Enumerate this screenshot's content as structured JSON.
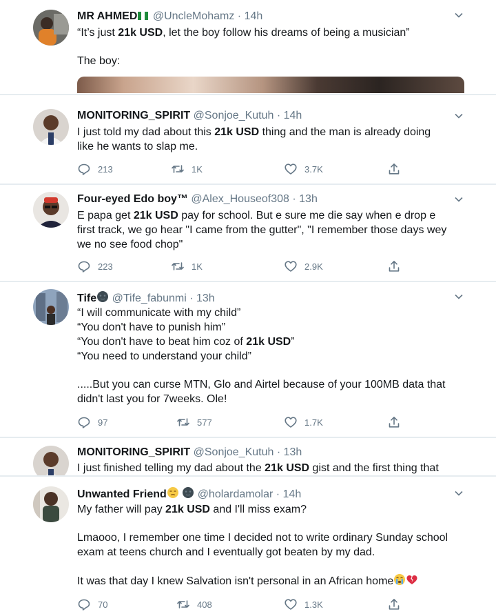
{
  "tweets": [
    {
      "name": "MR AHMED",
      "handle": "@UncleMohamz",
      "time": "14h",
      "lines": [
        [
          "“It’s just ",
          "21k USD",
          ", let the boy follow his dreams of being a musician”"
        ],
        [],
        [
          "The boy:"
        ]
      ]
    },
    {
      "name": "MONITORING_SPIRIT",
      "handle": "@Sonjoe_Kutuh",
      "time": "14h",
      "lines": [
        [
          "I just told my dad about this ",
          "21k USD",
          " thing and the man is already doing"
        ],
        [
          "like he wants to slap me."
        ]
      ],
      "replies": "213",
      "retweets": "1K",
      "likes": "3.7K"
    },
    {
      "name": "Four-eyed Edo boy™",
      "handle": "@Alex_Houseof308",
      "time": "13h",
      "lines": [
        [
          "E papa get ",
          "21k USD",
          " pay for school. But e sure me die say when e drop e"
        ],
        [
          "first track, we go hear \"I came from the gutter\", \"I remember those days wey"
        ],
        [
          "we no see food chop\""
        ]
      ],
      "replies": "223",
      "retweets": "1K",
      "likes": "2.9K"
    },
    {
      "name": "Tife",
      "handle": "@Tife_fabunmi",
      "time": "13h",
      "lines": [
        [
          "“I will communicate with my child”"
        ],
        [
          "“You don't have to punish him”"
        ],
        [
          "“You don't have to beat him coz of ",
          "21k USD",
          "”"
        ],
        [
          "“You need to understand your child”"
        ],
        [],
        [
          ".....But you can curse MTN, Glo and Airtel because of your 100MB data that"
        ],
        [
          "didn't last you for 7weeks. Ole!"
        ]
      ],
      "replies": "97",
      "retweets": "577",
      "likes": "1.7K"
    },
    {
      "name": "MONITORING_SPIRIT",
      "handle": "@Sonjoe_Kutuh",
      "time": "13h",
      "lines": [
        [
          "I just finished telling my dad about the ",
          "21k USD",
          " gist and the first thing that"
        ]
      ]
    },
    {
      "name": "Unwanted Friend",
      "handle": "@holardamolar",
      "time": "14h",
      "lines": [
        [
          "My father will pay ",
          "21k USD",
          " and I'll miss exam?"
        ],
        [],
        [
          "Lmaooo, I remember one time I decided not to write ordinary Sunday school"
        ],
        [
          "exam at teens church and I eventually got beaten by my dad."
        ],
        [],
        [
          "It was that day I knew Salvation isn't personal in an African home"
        ]
      ],
      "replies": "70",
      "retweets": "408",
      "likes": "1.3K"
    }
  ],
  "icons": {
    "reply": "reply-icon",
    "retweet": "retweet-icon",
    "like": "heart-icon",
    "share": "share-icon",
    "menu": "chevron-down-icon"
  },
  "colors": {
    "text": "#14171a",
    "muted": "#657786",
    "divider": "#e6ecf0"
  }
}
